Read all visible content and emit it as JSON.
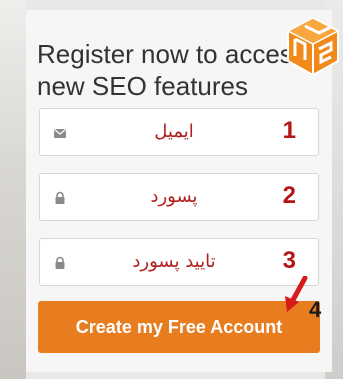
{
  "headline": {
    "line1": "Register now to access",
    "line2": "new SEO features"
  },
  "fields": [
    {
      "label": "ایمیل",
      "step": "1",
      "icon": "envelope-icon"
    },
    {
      "label": "پسورد",
      "step": "2",
      "icon": "lock-icon"
    },
    {
      "label": "تایید پسورد",
      "step": "3",
      "icon": "lock-icon"
    }
  ],
  "submit": {
    "label": "Create my Free Account",
    "step": "4"
  },
  "colors": {
    "button": "#e87d20",
    "annotation": "#b51515",
    "arrow": "#d81b1b",
    "logo": "#f08a1a"
  },
  "logo": {
    "icon": "cube-logo-icon"
  }
}
